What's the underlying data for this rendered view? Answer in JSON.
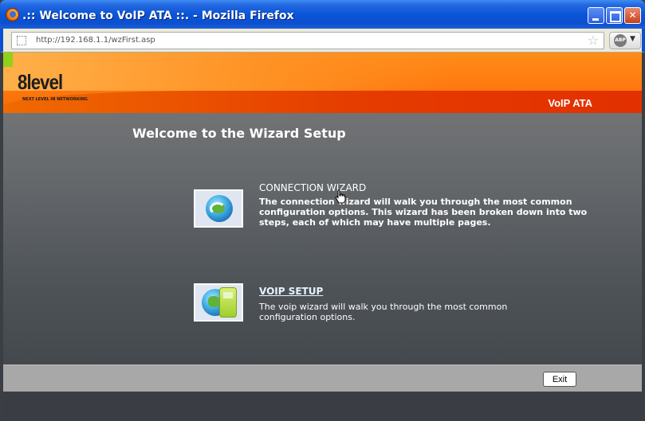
{
  "window": {
    "title": ".:: Welcome to VoIP ATA ::. - Mozilla Firefox",
    "url": "http://192.168.1.1/wzFirst.asp"
  },
  "browser": {
    "adblock_label": "ABP",
    "star_glyph": "☆",
    "dropdown_glyph": "▼"
  },
  "header": {
    "logo_text": "8level",
    "logo_tagline": "NEXT LEVEL IN NETWORKING",
    "product_name": "VoIP ATA"
  },
  "main": {
    "title": "Welcome to the Wizard Setup",
    "wizards": [
      {
        "label": "CONNECTION WIZARD",
        "description": "The connection wizard will walk you through the most common configuration options. This wizard has been broken down into two steps, each of which may have multiple pages.",
        "icon": "globe-icon"
      },
      {
        "label": "VOIP SETUP",
        "description": "The voip wizard will walk you through the most common configuration options.",
        "icon": "phone-globe-icon"
      }
    ]
  },
  "footer": {
    "exit_label": "Exit"
  },
  "colors": {
    "header_orange": "#ff8c19",
    "band_red": "#e53c00",
    "accent_green": "#8fd21a"
  }
}
